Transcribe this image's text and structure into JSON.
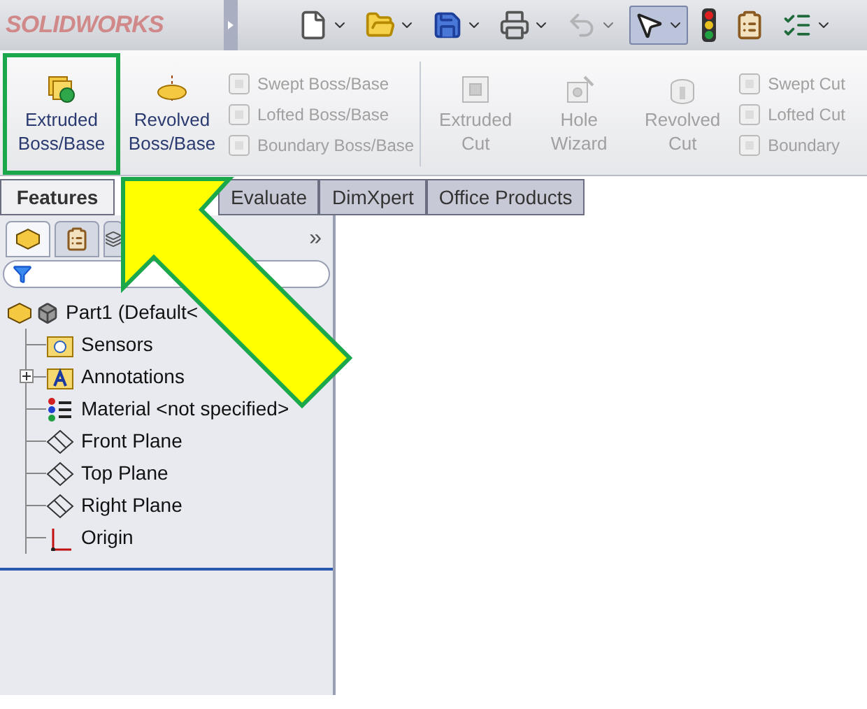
{
  "app": {
    "logo": "SOLIDWORKS"
  },
  "toolbar": [
    {
      "kind": "new",
      "dropdown": true,
      "selected": false,
      "disabled": false
    },
    {
      "kind": "open",
      "dropdown": true,
      "selected": false,
      "disabled": false
    },
    {
      "kind": "save",
      "dropdown": true,
      "selected": false,
      "disabled": false
    },
    {
      "kind": "print",
      "dropdown": true,
      "selected": false,
      "disabled": false
    },
    {
      "kind": "undo",
      "dropdown": true,
      "selected": false,
      "disabled": true
    },
    {
      "kind": "select",
      "dropdown": true,
      "selected": true,
      "disabled": false
    },
    {
      "kind": "rebuild",
      "dropdown": false,
      "selected": false,
      "disabled": false
    },
    {
      "kind": "properties",
      "dropdown": false,
      "selected": false,
      "disabled": false
    },
    {
      "kind": "options",
      "dropdown": true,
      "selected": false,
      "disabled": false
    }
  ],
  "ribbon": [
    {
      "kind": "extrude",
      "label": "Extruded Boss/Base",
      "disabled": false,
      "highlighted": true
    },
    {
      "kind": "revolve",
      "label": "Revolved Boss/Base",
      "disabled": false,
      "highlighted": false
    },
    {
      "kind": "stack",
      "items": [
        {
          "label": "Swept Boss/Base",
          "disabled": true
        },
        {
          "label": "Lofted Boss/Base",
          "disabled": true
        },
        {
          "label": "Boundary Boss/Base",
          "disabled": true
        }
      ]
    },
    {
      "kind": "separator"
    },
    {
      "kind": "cut",
      "label": "Extruded Cut",
      "disabled": true,
      "highlighted": false
    },
    {
      "kind": "hole",
      "label": "Hole Wizard",
      "disabled": true,
      "highlighted": false
    },
    {
      "kind": "revcut",
      "label": "Revolved Cut",
      "disabled": true,
      "highlighted": false
    },
    {
      "kind": "stack",
      "items": [
        {
          "label": "Swept Cut",
          "disabled": true
        },
        {
          "label": "Lofted Cut",
          "disabled": true
        },
        {
          "label": "Boundary",
          "disabled": true
        }
      ]
    }
  ],
  "tabs": [
    {
      "label": "Features",
      "selected": true
    },
    {
      "label": "Evaluate",
      "selected": false
    },
    {
      "label": "DimXpert",
      "selected": false
    },
    {
      "label": "Office Products",
      "selected": false
    }
  ],
  "panel_tabs": [
    {
      "kind": "tree",
      "selected": true
    },
    {
      "kind": "property",
      "selected": false
    },
    {
      "kind": "config",
      "selected": false
    }
  ],
  "panel_more": "»",
  "tree": [
    {
      "label": "Part1  (Default<",
      "kind": "part",
      "children": [
        {
          "label": "Sensors",
          "kind": "sensors"
        },
        {
          "label": "Annotations",
          "kind": "annotations",
          "expanded": false
        },
        {
          "label": "Material <not specified>",
          "kind": "material"
        },
        {
          "label": "Front Plane",
          "kind": "plane"
        },
        {
          "label": "Top Plane",
          "kind": "plane"
        },
        {
          "label": "Right Plane",
          "kind": "plane"
        },
        {
          "label": "Origin",
          "kind": "origin"
        }
      ]
    }
  ]
}
